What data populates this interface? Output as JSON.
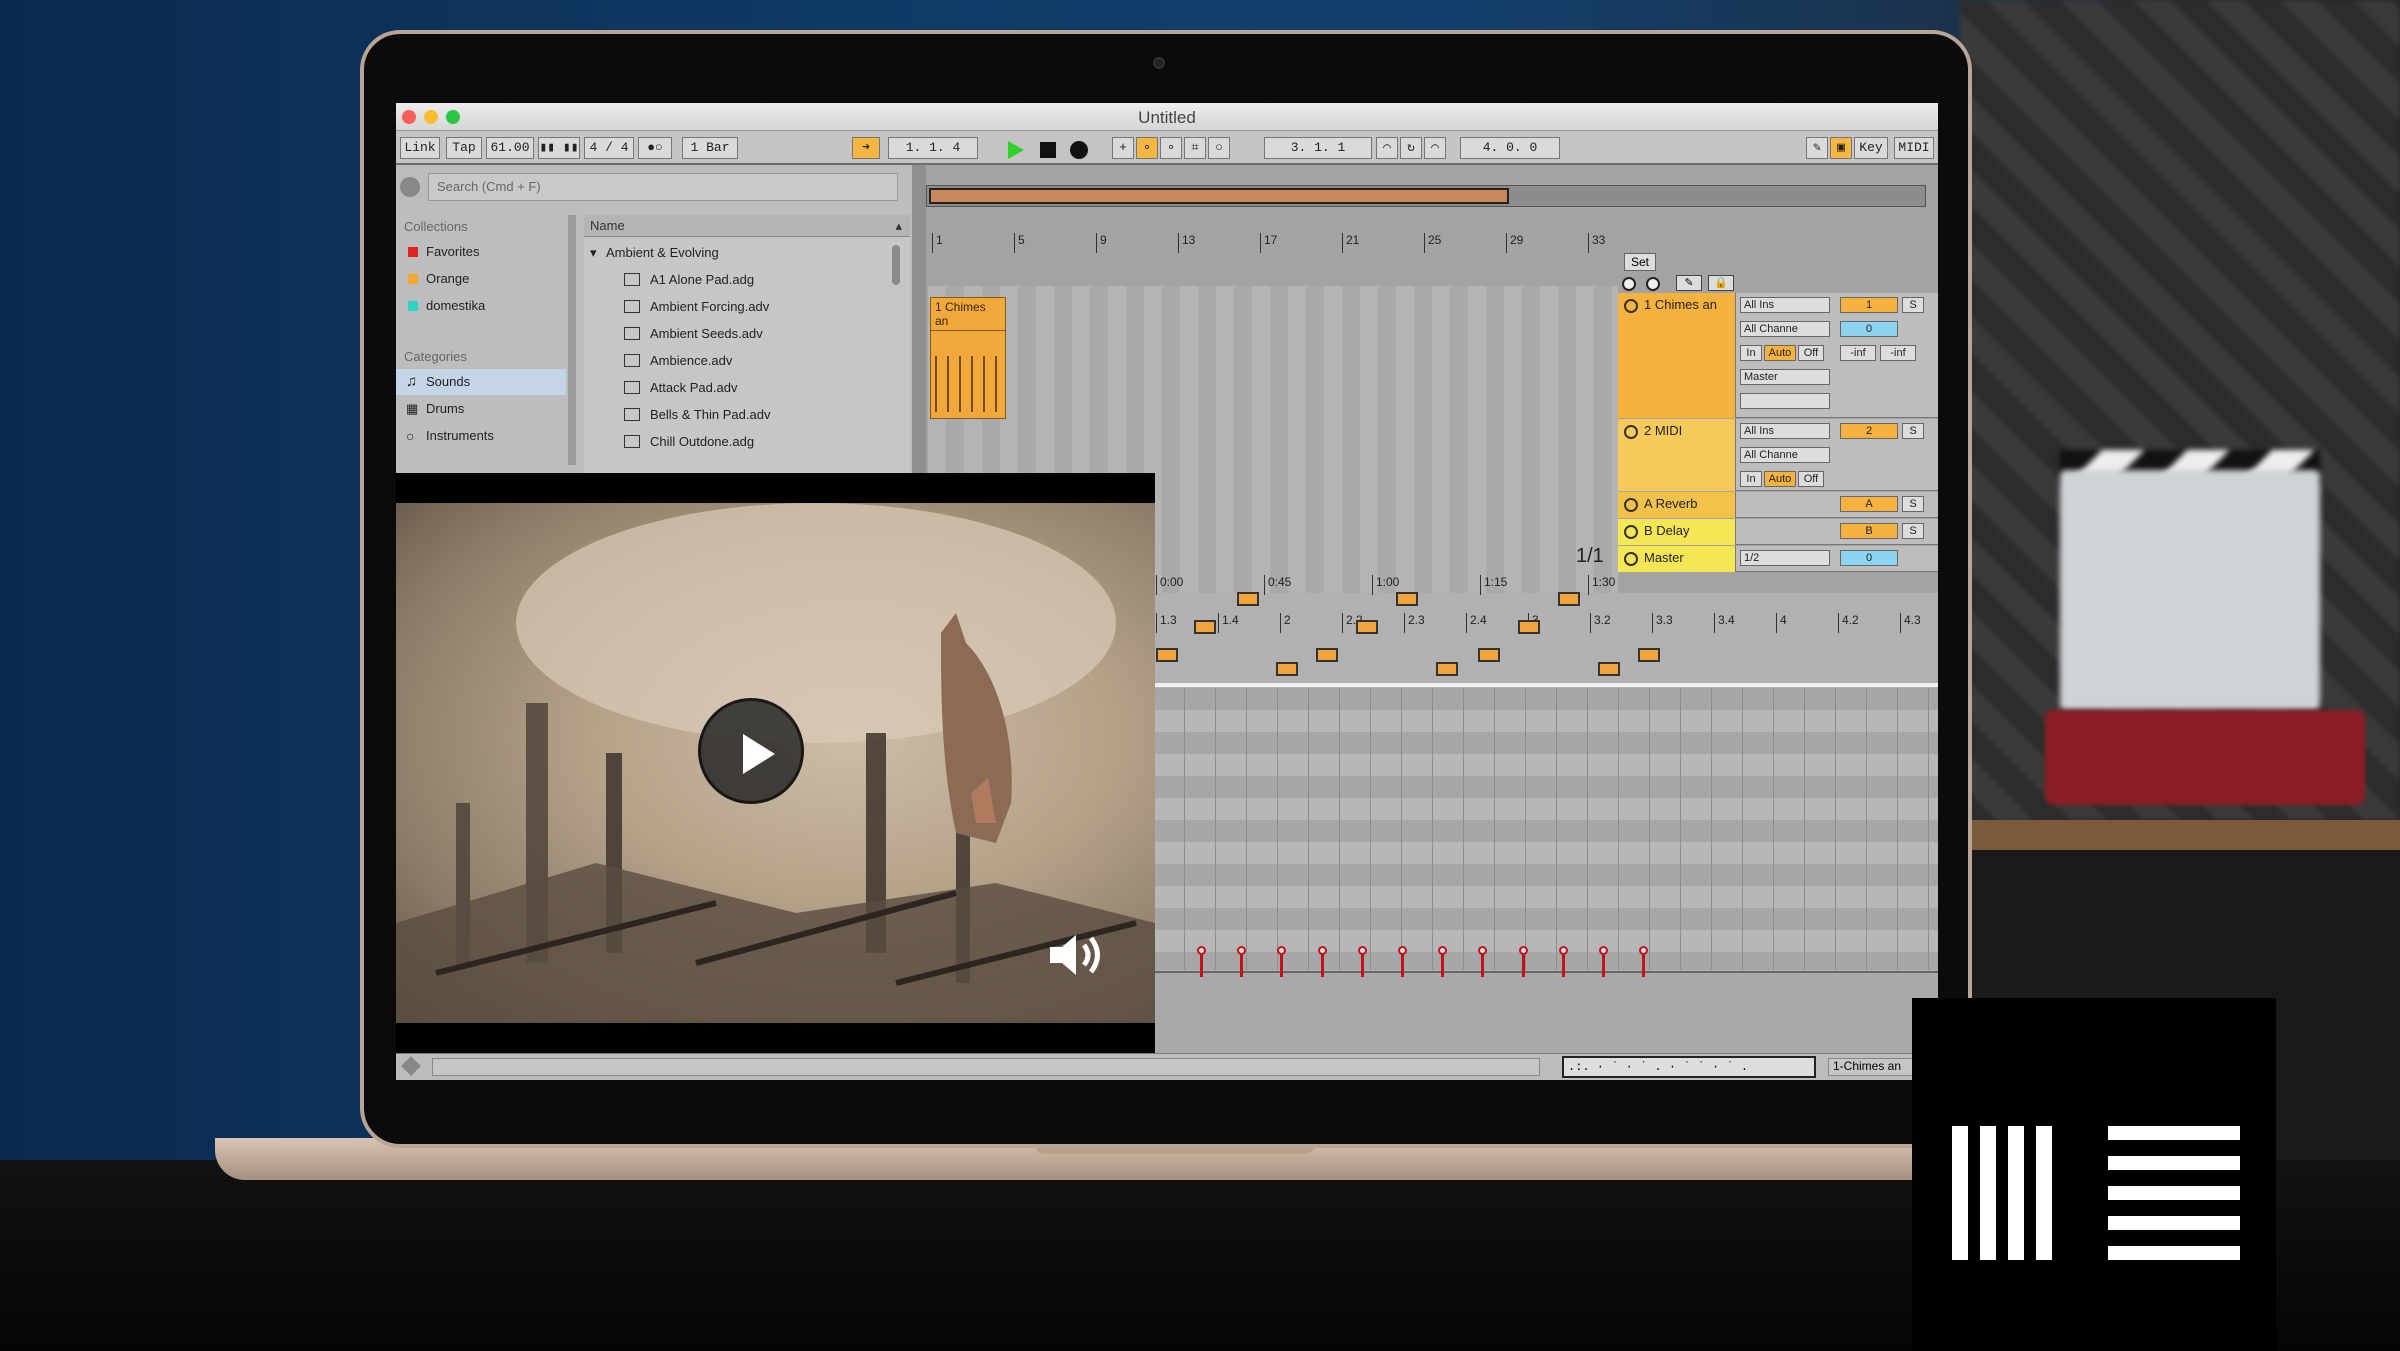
{
  "window": {
    "title": "Untitled"
  },
  "control_bar": {
    "link": "Link",
    "tap": "Tap",
    "tempo": "61.00",
    "sig": "4 / 4",
    "quant": "1 Bar",
    "position": "1.  1.  4",
    "loop_start": "3.  1.  1",
    "loop_len": "4.  0.  0",
    "key": "Key",
    "midi": "MIDI"
  },
  "browser": {
    "search_placeholder": "Search (Cmd + F)",
    "collections_header": "Collections",
    "collections": [
      {
        "label": "Favorites",
        "color": "#e02424"
      },
      {
        "label": "Orange",
        "color": "#f0a830"
      },
      {
        "label": "domestika",
        "color": "#2ad8c2"
      }
    ],
    "categories_header": "Categories",
    "categories": [
      {
        "label": "Sounds",
        "icon": "note-icon"
      },
      {
        "label": "Drums",
        "icon": "drum-grid-icon"
      },
      {
        "label": "Instruments",
        "icon": "instrument-icon"
      }
    ],
    "column_name": "Name",
    "folder": "Ambient & Evolving",
    "files": [
      "A1 Alone Pad.adg",
      "Ambient Forcing.adv",
      "Ambient Seeds.adv",
      "Ambience.adv",
      "Attack Pad.adv",
      "Bells & Thin Pad.adv",
      "Chill Outdone.adg"
    ]
  },
  "arrangement": {
    "ruler": [
      "1",
      "5",
      "9",
      "13",
      "17",
      "21",
      "25",
      "29",
      "33"
    ],
    "set_label": "Set",
    "clip_name": "1 Chimes an",
    "tracks": [
      {
        "name": "1 Chimes an",
        "input": "All Ins",
        "channel": "All Channe",
        "monitor": [
          "In",
          "Auto",
          "Off"
        ],
        "output": "Master",
        "number": "1",
        "send": "0",
        "vol": "-inf",
        "vol2": "-inf",
        "color": "#f5b23e"
      },
      {
        "name": "2 MIDI",
        "input": "All Ins",
        "channel": "All Channe",
        "monitor": [
          "In",
          "Auto",
          "Off"
        ],
        "number": "2",
        "color": "#f5c95a"
      },
      {
        "name": "A Reverb",
        "number": "A",
        "color": "#f2c24a"
      },
      {
        "name": "B Delay",
        "number": "B",
        "color": "#f5e656"
      },
      {
        "name": "Master",
        "input": "1/2",
        "number": "0",
        "color": "#f5e656"
      }
    ],
    "fraction": "1/1",
    "time_ruler": [
      "0:00",
      "0:45",
      "1:00",
      "1:15",
      "1:30"
    ]
  },
  "midi_editor": {
    "ruler": [
      "1.3",
      "1.4",
      "2",
      "2.2",
      "2.3",
      "2.4",
      "3",
      "3.2",
      "3.3",
      "3.4",
      "4",
      "4.2",
      "4.3"
    ],
    "clip_label": "1-Chimes an"
  },
  "video": {
    "play_icon": "play-icon",
    "volume_icon": "speaker-icon"
  },
  "logo": {
    "name": "ableton-logo"
  }
}
